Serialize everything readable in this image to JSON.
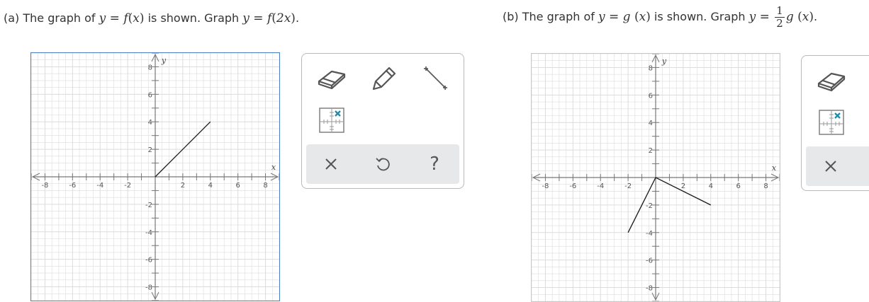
{
  "part_a": {
    "prefix": "(a) The graph of ",
    "given_lhs": "y",
    "given_fn": "f",
    "given_arg": "x",
    "middle": " is shown. Graph ",
    "target_lhs": "y",
    "target_fn": "f",
    "target_arg": "2x",
    "suffix": ".",
    "graph": {
      "x_axis_label": "x",
      "y_axis_label": "y",
      "x_ticks": [
        "-8",
        "-6",
        "-4",
        "-2",
        "2",
        "4",
        "6",
        "8"
      ],
      "y_ticks": [
        "8",
        "6",
        "4",
        "2",
        "-2",
        "-4",
        "-6",
        "-8"
      ],
      "xlim": [
        -9,
        9
      ],
      "ylim": [
        -9,
        9
      ],
      "segments": [
        [
          [
            0,
            0
          ],
          [
            4,
            4
          ]
        ]
      ],
      "frame_color": "#4a7fc1"
    }
  },
  "part_b": {
    "prefix": "(b) The graph of ",
    "given_lhs": "y",
    "given_fn": "g",
    "given_arg": "x",
    "middle": " is shown. Graph ",
    "target_lhs": "y",
    "frac_num": "1",
    "frac_den": "2",
    "target_fn": "g",
    "target_arg": "x",
    "suffix": ".",
    "graph": {
      "x_axis_label": "x",
      "y_axis_label": "y",
      "x_ticks": [
        "-8",
        "-6",
        "-4",
        "-2",
        "2",
        "4",
        "6",
        "8"
      ],
      "y_ticks": [
        "8",
        "6",
        "4",
        "2",
        "-2",
        "-4",
        "-6",
        "-8"
      ],
      "xlim": [
        -9,
        9
      ],
      "ylim": [
        -9,
        9
      ],
      "segments": [
        [
          [
            -2,
            -4
          ],
          [
            0,
            0
          ]
        ],
        [
          [
            0,
            0
          ],
          [
            4,
            -2
          ]
        ]
      ],
      "frame_color": "#c8c8c8"
    }
  },
  "toolbox": {
    "tools": [
      "eraser-icon",
      "pencil-icon",
      "line-segment-icon",
      "grid-point-icon"
    ],
    "actions": [
      "close-icon",
      "undo-icon",
      "help-icon"
    ],
    "help_label": "?"
  },
  "colors": {
    "grid": "#dcdcdc",
    "axis": "#777777",
    "curve": "#1a1a1a",
    "icon": "#555555",
    "accent": "#1b8fae"
  }
}
